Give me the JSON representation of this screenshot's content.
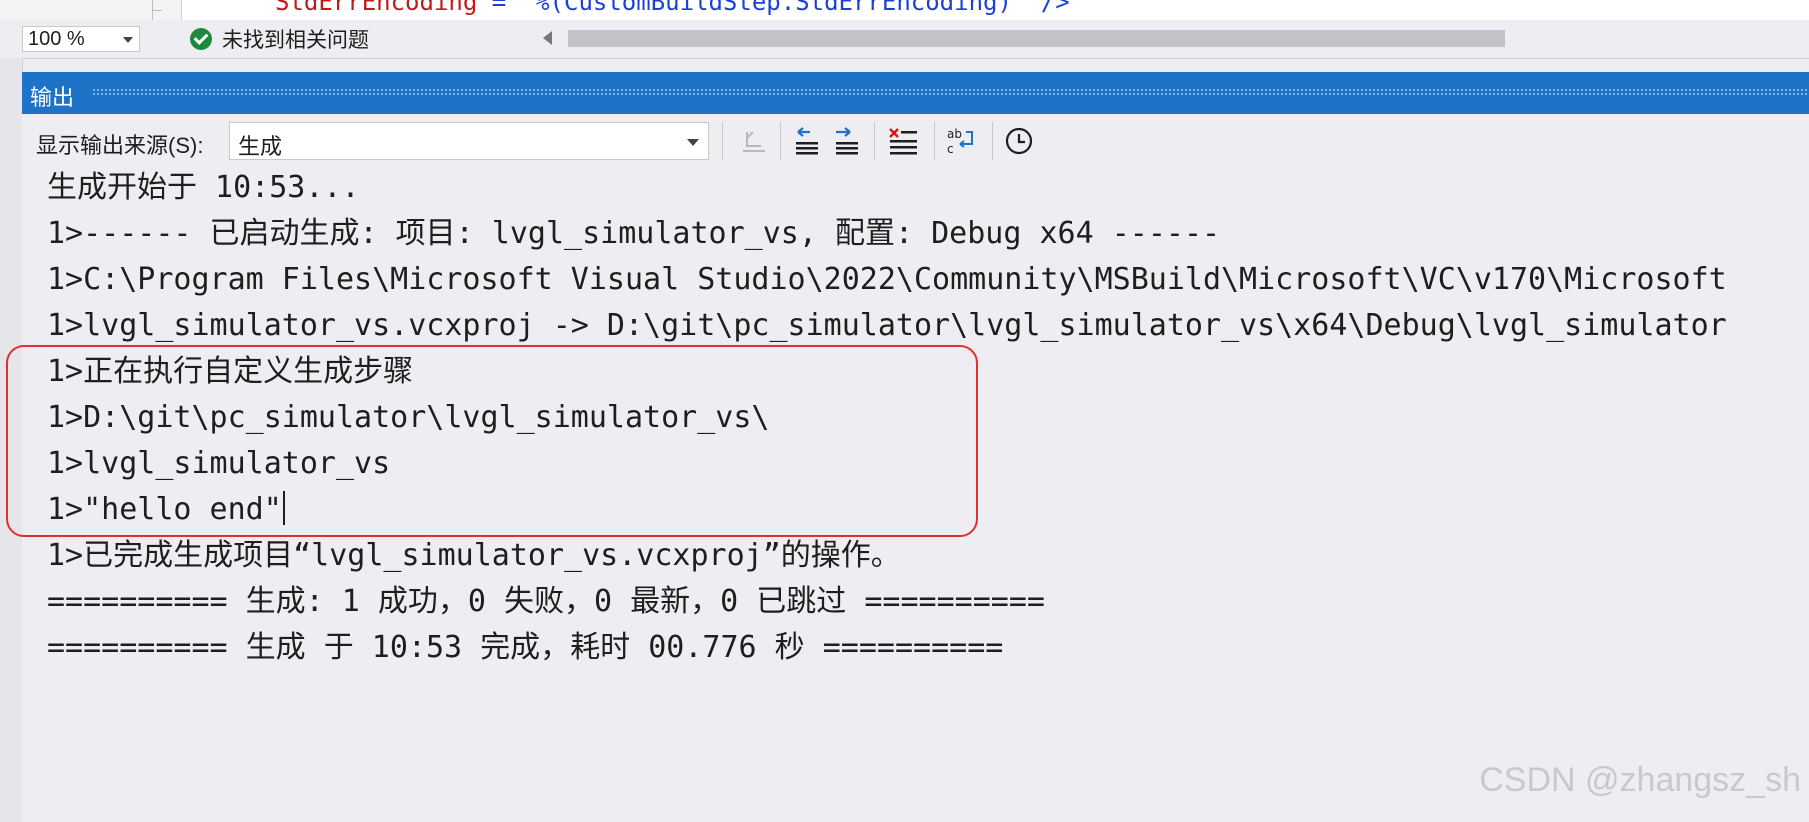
{
  "editor": {
    "code_attr": "StdErrEncoding",
    "code_rest": " = \"%(CustomBuildStep.StdErrEncoding)\" />",
    "zoom": "100 %",
    "issues_status": "未找到相关问题"
  },
  "output_panel": {
    "title": "输出",
    "source_label": "显示输出来源(S):",
    "source_value": "生成",
    "toolbar_icons": [
      "goto-error-icon",
      "find-previous-icon",
      "find-next-icon",
      "clear-all-icon",
      "toggle-word-wrap-icon",
      "toggle-timestamp-icon"
    ],
    "lines": [
      "生成开始于 10:53...",
      "1>------ 已启动生成: 项目: lvgl_simulator_vs, 配置: Debug x64 ------",
      "1>C:\\Program Files\\Microsoft Visual Studio\\2022\\Community\\MSBuild\\Microsoft\\VC\\v170\\Microsoft",
      "1>lvgl_simulator_vs.vcxproj -> D:\\git\\pc_simulator\\lvgl_simulator_vs\\x64\\Debug\\lvgl_simulator",
      "1>正在执行自定义生成步骤",
      "1>D:\\git\\pc_simulator\\lvgl_simulator_vs\\",
      "1>lvgl_simulator_vs",
      "1>\"hello end\"",
      "1>已完成生成项目“lvgl_simulator_vs.vcxproj”的操作。",
      "========== 生成: 1 成功，0 失败，0 最新，0 已跳过 ==========",
      "========== 生成 于 10:53 完成，耗时 00.776 秒 =========="
    ],
    "highlight_color": "#e03131"
  },
  "watermark": "CSDN @zhangsz_sh"
}
